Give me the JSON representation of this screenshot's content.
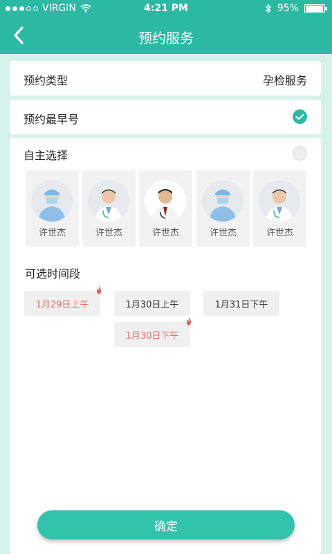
{
  "status_bar": {
    "carrier": "VIRGIN",
    "time": "4:21 PM",
    "battery": "95%",
    "battery_level": 0.95
  },
  "header": {
    "title": "预约服务"
  },
  "appointment_type": {
    "label": "预约类型",
    "value": "孕检服务"
  },
  "earliest": {
    "label": "预约最早号",
    "checked": true
  },
  "self_select": {
    "label": "自主选择",
    "checked": false,
    "doctors": [
      {
        "name": "许世杰",
        "attire": "surgical"
      },
      {
        "name": "许世杰",
        "attire": "coat"
      },
      {
        "name": "许世杰",
        "attire": "coat"
      },
      {
        "name": "许世杰",
        "attire": "surgical"
      },
      {
        "name": "许世杰",
        "attire": "coat"
      }
    ]
  },
  "time_slots": {
    "title": "可选时间段",
    "slots": [
      {
        "label": "1月29日上午",
        "hot": true
      },
      {
        "label": "1月30日上午",
        "hot": false
      },
      {
        "label": "1月31日下午",
        "hot": false
      },
      {
        "label": "1月30日下午",
        "hot": true
      }
    ]
  },
  "confirm_label": "确定",
  "colors": {
    "brand": "#2bb9a4",
    "background": "#d5f1ec",
    "hot_text": "#e86a6a"
  }
}
